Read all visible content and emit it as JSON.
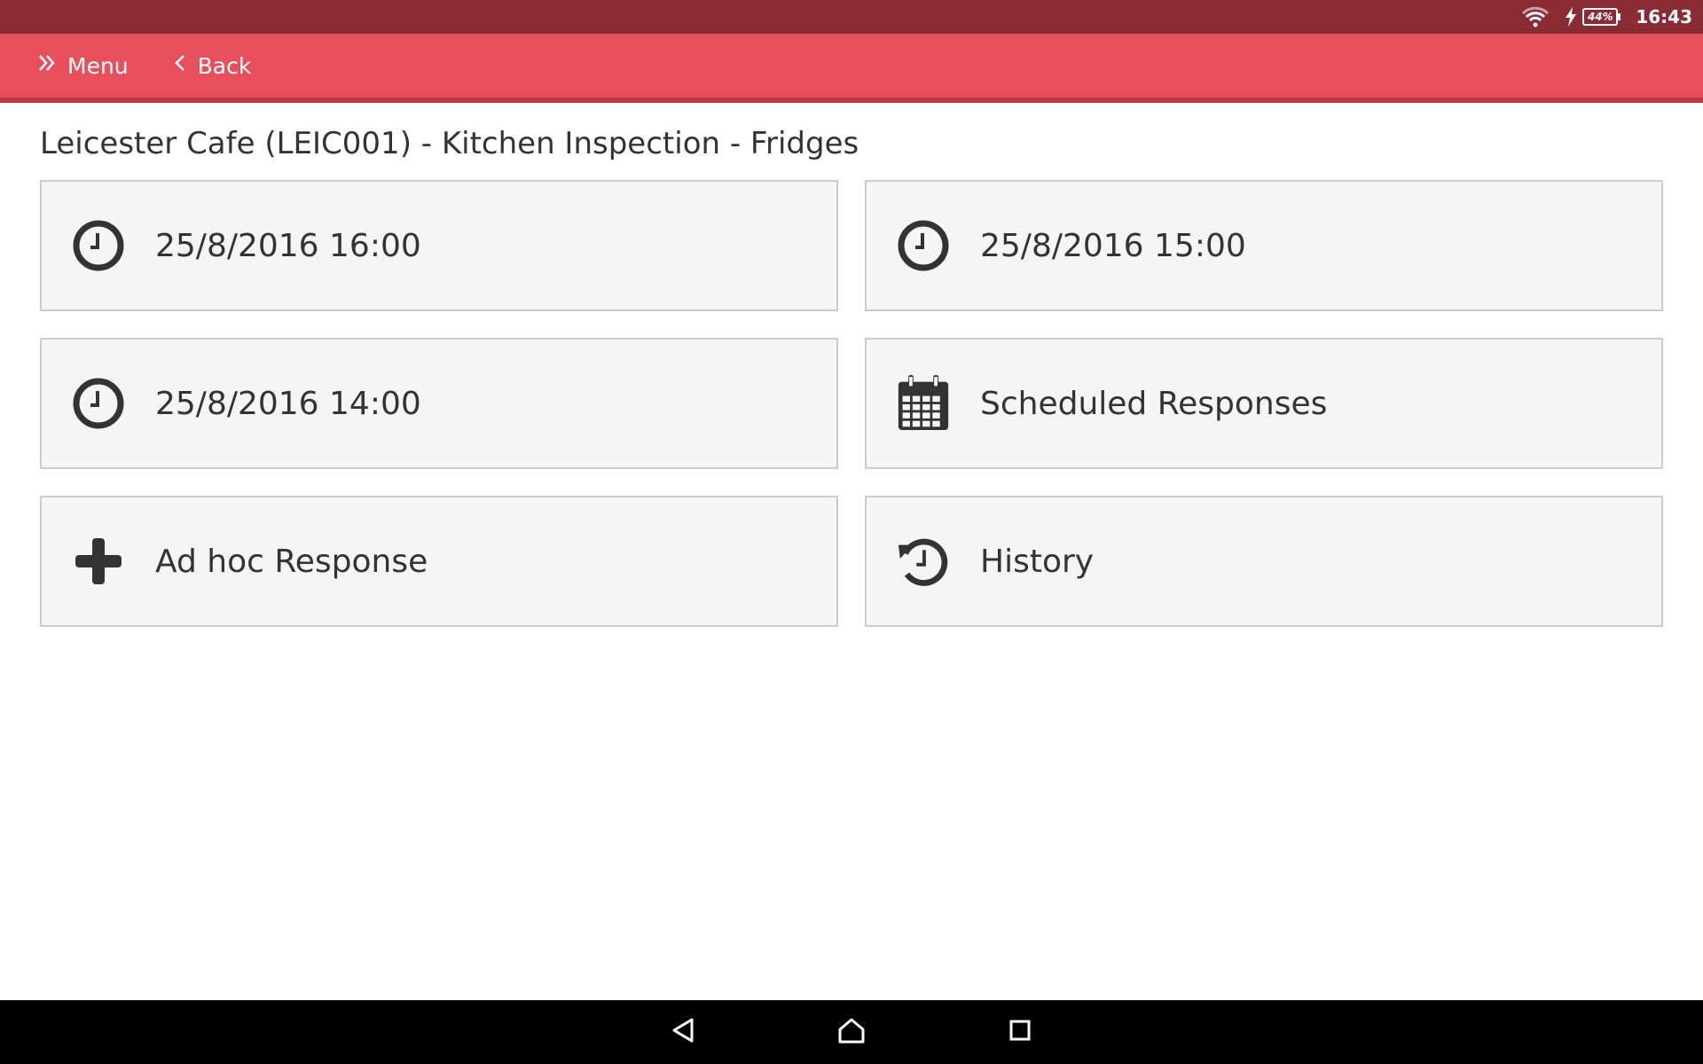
{
  "colors": {
    "status_bar": "#8b2b33",
    "app_bar": "#e94e5b",
    "app_bar_border": "#b83a45",
    "nav_bar": "#000000",
    "icon": "#333333"
  },
  "status_bar": {
    "battery_level": "44%",
    "time": "16:43",
    "icons": [
      "wifi-icon",
      "charging-bolt-icon",
      "battery-icon"
    ]
  },
  "app_bar": {
    "menu_label": "Menu",
    "back_label": "Back",
    "menu_icon": "double-chevron-right-icon",
    "back_icon": "chevron-left-icon"
  },
  "page": {
    "title": "Leicester Cafe (LEIC001) - Kitchen Inspection - Fridges"
  },
  "tiles": [
    {
      "label": "25/8/2016 16:00",
      "icon": "clock-icon"
    },
    {
      "label": "25/8/2016 15:00",
      "icon": "clock-icon"
    },
    {
      "label": "25/8/2016 14:00",
      "icon": "clock-icon"
    },
    {
      "label": "Scheduled Responses",
      "icon": "calendar-icon"
    },
    {
      "label": "Ad hoc Response",
      "icon": "plus-icon"
    },
    {
      "label": "History",
      "icon": "history-icon"
    }
  ],
  "system_nav": {
    "buttons": [
      "back-triangle-icon",
      "home-icon",
      "recents-icon"
    ]
  }
}
